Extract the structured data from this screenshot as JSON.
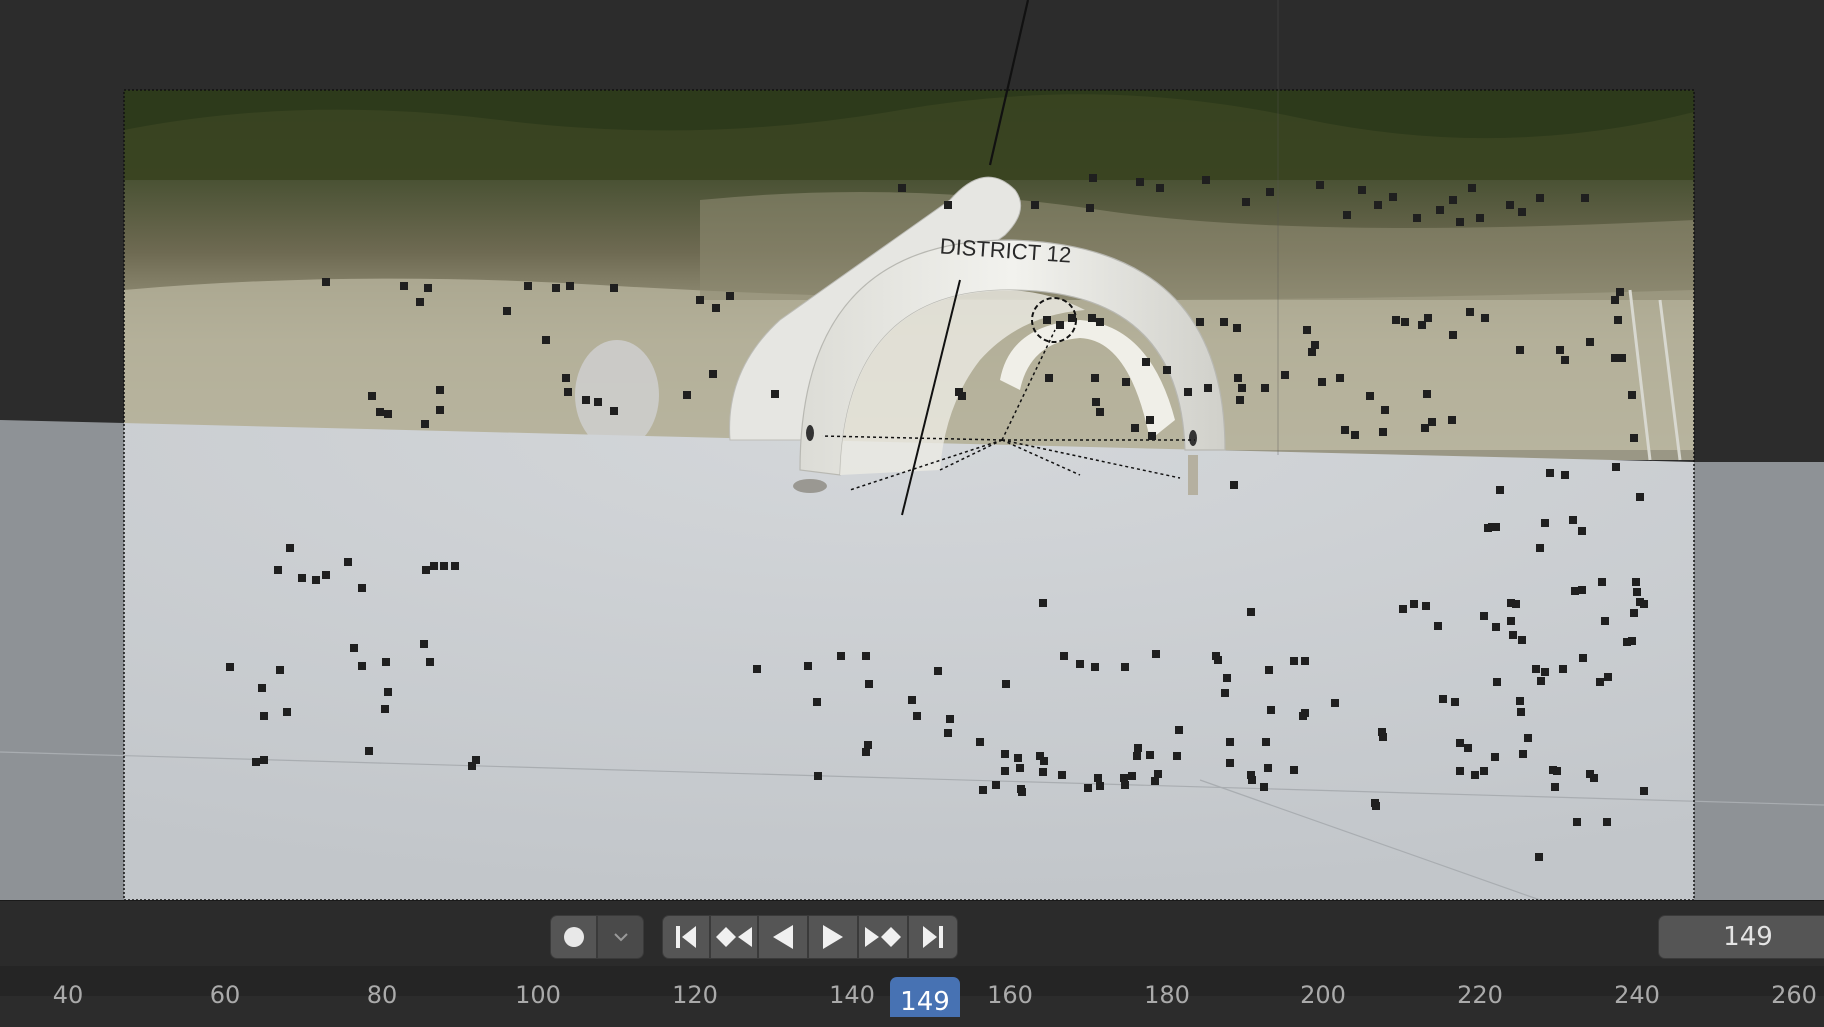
{
  "viewport": {
    "camera_overlay_label": "DISTRICT 12",
    "colors": {
      "background": "#2c2c2c",
      "floor": "#c9ccd0",
      "marker": "#1f1f1f"
    }
  },
  "transport": {
    "record_icon": "record-icon",
    "record_menu_icon": "chevron-down-icon",
    "jump_start_icon": "jump-to-start-icon",
    "prev_keyframe_icon": "previous-keyframe-icon",
    "play_reverse_icon": "play-reverse-icon",
    "play_icon": "play-icon",
    "next_keyframe_icon": "next-keyframe-icon",
    "jump_end_icon": "jump-to-end-icon",
    "current_frame": "149"
  },
  "ruler": {
    "labels": [
      "40",
      "60",
      "80",
      "100",
      "120",
      "140",
      "160",
      "180",
      "200",
      "220",
      "240",
      "260"
    ],
    "current_frame_label": "149",
    "accent_color": "#4772b3"
  }
}
